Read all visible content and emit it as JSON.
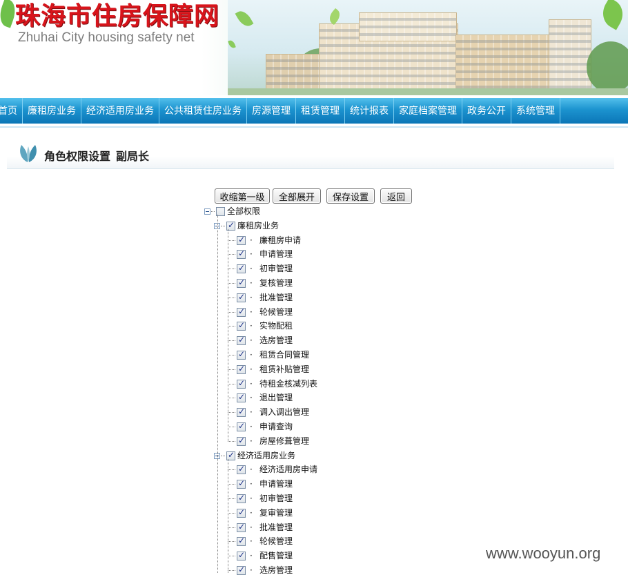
{
  "header": {
    "site_name_cn": "珠海市住房保障网",
    "site_name_en": "Zhuhai City housing safety net"
  },
  "nav": {
    "items": [
      "首页",
      "廉租房业务",
      "经济适用房业务",
      "公共租赁住房业务",
      "房源管理",
      "租赁管理",
      "统计报表",
      "家庭档案管理",
      "政务公开",
      "系统管理"
    ]
  },
  "page": {
    "title": "角色权限设置",
    "role": "副局长"
  },
  "buttons": {
    "collapse_first_level": "收缩第一级",
    "expand_all": "全部展开",
    "save_settings": "保存设置",
    "back": "返回"
  },
  "tree": {
    "root": {
      "label": "全部权限",
      "checked": false
    },
    "groups": [
      {
        "label": "廉租房业务",
        "checked": true,
        "children": [
          {
            "label": "廉租房申请",
            "checked": true
          },
          {
            "label": "申请管理",
            "checked": true
          },
          {
            "label": "初审管理",
            "checked": true
          },
          {
            "label": "复核管理",
            "checked": true
          },
          {
            "label": "批准管理",
            "checked": true
          },
          {
            "label": "轮候管理",
            "checked": true
          },
          {
            "label": "实物配租",
            "checked": true
          },
          {
            "label": "选房管理",
            "checked": true
          },
          {
            "label": "租赁合同管理",
            "checked": true
          },
          {
            "label": "租赁补贴管理",
            "checked": true
          },
          {
            "label": "待租金核减列表",
            "checked": true
          },
          {
            "label": "退出管理",
            "checked": true
          },
          {
            "label": "调入调出管理",
            "checked": true
          },
          {
            "label": "申请查询",
            "checked": true
          },
          {
            "label": "房屋修葺管理",
            "checked": true
          }
        ]
      },
      {
        "label": "经济适用房业务",
        "checked": true,
        "children": [
          {
            "label": "经济适用房申请",
            "checked": true
          },
          {
            "label": "申请管理",
            "checked": true
          },
          {
            "label": "初审管理",
            "checked": true
          },
          {
            "label": "复审管理",
            "checked": true
          },
          {
            "label": "批准管理",
            "checked": true
          },
          {
            "label": "轮候管理",
            "checked": true
          },
          {
            "label": "配售管理",
            "checked": true
          },
          {
            "label": "选房管理",
            "checked": true
          }
        ]
      }
    ]
  },
  "bullet_char": "·",
  "watermark": "www.wooyun.org"
}
